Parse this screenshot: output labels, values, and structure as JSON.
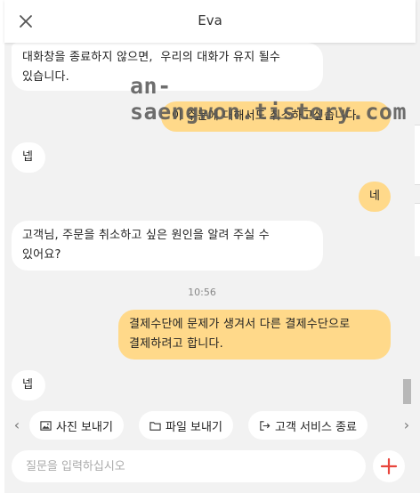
{
  "header": {
    "title": "Eva"
  },
  "watermark": "an-saengwon.tistory.com",
  "messages": [
    {
      "from": "bot",
      "text": "대화창을 종료하지 않으면,  우리의 대화가 유지 될수\n있습니다."
    },
    {
      "from": "user",
      "text": "이 주문에 대해서도 취소하고싶습니다"
    },
    {
      "from": "bot",
      "text": "넵"
    },
    {
      "from": "user",
      "text": "네"
    },
    {
      "from": "bot",
      "text": "고객님, 주문을 취소하고 싶은 원인을 알려 주실 수\n있어요?"
    },
    {
      "from": "user",
      "text": "결제수단에 문제가 생겨서 다른 결제수단으로\n결제하려고 합니다."
    },
    {
      "from": "bot",
      "text": "넵"
    }
  ],
  "timestamp": "10:56",
  "quick_replies": [
    {
      "label": "사진 보내기",
      "icon": "image-icon"
    },
    {
      "label": "파일 보내기",
      "icon": "folder-icon"
    },
    {
      "label": "고객 서비스 종료",
      "icon": "exit-icon"
    }
  ],
  "input": {
    "placeholder": "질문을 입력하십시오",
    "value": ""
  },
  "colors": {
    "user_bubble": "#ffd98a",
    "bot_bubble": "#ffffff",
    "background": "#f2f2f2",
    "add_button": "#e8453c"
  }
}
